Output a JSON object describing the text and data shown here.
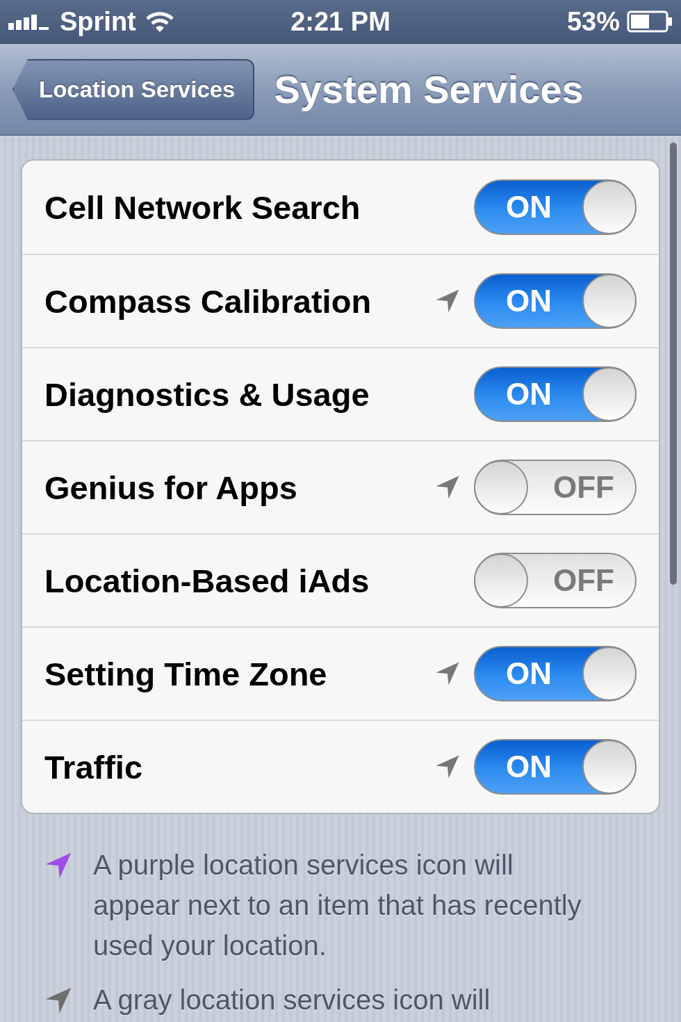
{
  "status_bar": {
    "carrier": "Sprint",
    "time": "2:21 PM",
    "battery": "53%"
  },
  "nav_bar": {
    "back": "Location Services",
    "title": "System Services"
  },
  "rows": [
    {
      "label": "Cell Network Search",
      "location_icon": false,
      "on": true,
      "toggle_text": "ON"
    },
    {
      "label": "Compass Calibration",
      "location_icon": true,
      "on": true,
      "toggle_text": "ON"
    },
    {
      "label": "Diagnostics & Usage",
      "location_icon": false,
      "on": true,
      "toggle_text": "ON"
    },
    {
      "label": "Genius for Apps",
      "location_icon": true,
      "on": false,
      "toggle_text": "OFF"
    },
    {
      "label": "Location-Based iAds",
      "location_icon": false,
      "on": false,
      "toggle_text": "OFF"
    },
    {
      "label": "Setting Time Zone",
      "location_icon": true,
      "on": true,
      "toggle_text": "ON"
    },
    {
      "label": "Traffic",
      "location_icon": true,
      "on": true,
      "toggle_text": "ON"
    }
  ],
  "notes": [
    {
      "color": "#9b4de8",
      "text": "A purple location services icon will appear next to an item that has recently used your location."
    },
    {
      "color": "#6e6e6e",
      "text": "A gray location services icon will"
    }
  ]
}
